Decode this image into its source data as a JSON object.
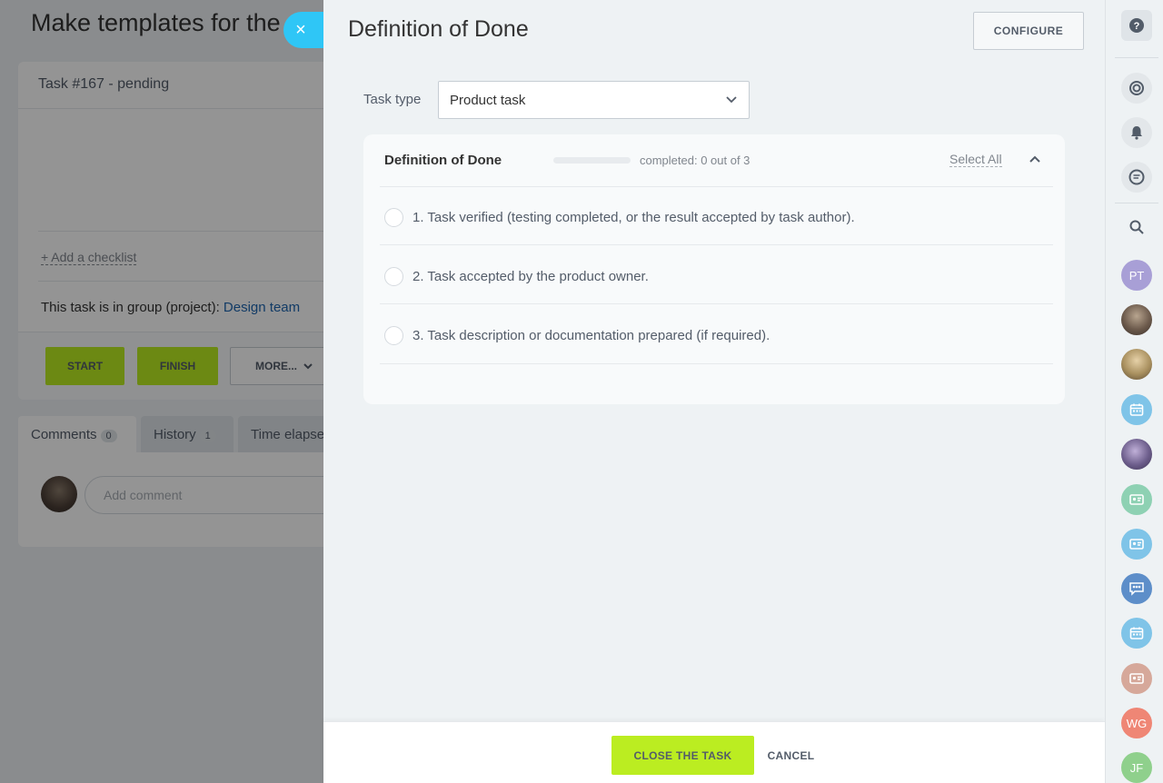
{
  "background_page": {
    "title": "Make templates for the p",
    "task_header": "Task #167 - pending",
    "add_checklist": "+ Add a checklist",
    "group_text": "This task is in group (project):",
    "group_link": "Design team",
    "buttons": {
      "start": "START",
      "finish": "FINISH",
      "more": "MORE..."
    },
    "tabs": [
      {
        "label": "Comments",
        "count": "0"
      },
      {
        "label": "History",
        "count": "1"
      },
      {
        "label": "Time elapse"
      }
    ],
    "comment_placeholder": "Add comment"
  },
  "slider": {
    "close_label": "×",
    "title": "Definition of Done",
    "configure_label": "CONFIGURE",
    "task_type_label": "Task type",
    "task_type_value": "Product task",
    "checklist": {
      "title": "Definition of Done",
      "progress_fraction": 0,
      "completed_text": "completed: 0 out of 3",
      "select_all": "Select All",
      "items": [
        {
          "label": "1. Task verified (testing completed, or the result accepted by task author).",
          "checked": false
        },
        {
          "label": "2. Task accepted by the product owner.",
          "checked": false
        },
        {
          "label": "3. Task description or documentation prepared (if required).",
          "checked": false
        }
      ]
    },
    "footer": {
      "close_task": "CLOSE THE TASK",
      "cancel": "CANCEL"
    }
  },
  "right_sidebar": {
    "items": [
      {
        "type": "icon",
        "icon": "help-icon"
      },
      {
        "type": "icon",
        "icon": "copilot-icon"
      },
      {
        "type": "icon",
        "icon": "bell-icon"
      },
      {
        "type": "icon",
        "icon": "chat-icon"
      },
      {
        "type": "icon",
        "icon": "search-icon"
      },
      {
        "type": "initials",
        "text": "PT",
        "color": "#a89fd6"
      },
      {
        "type": "photo",
        "icon": "user-photo"
      },
      {
        "type": "photo",
        "icon": "user-photo"
      },
      {
        "type": "icon",
        "icon": "calendar-icon",
        "color": "#7fc4e8"
      },
      {
        "type": "photo",
        "icon": "user-photo"
      },
      {
        "type": "icon",
        "icon": "contact-card-icon",
        "color": "#8ed1b3"
      },
      {
        "type": "icon",
        "icon": "contact-card-icon",
        "color": "#7fc4e8"
      },
      {
        "type": "icon",
        "icon": "group-chat-icon",
        "color": "#5d8ec9"
      },
      {
        "type": "icon",
        "icon": "calendar-icon",
        "color": "#7fc4e8"
      },
      {
        "type": "icon",
        "icon": "contact-card-icon",
        "color": "#d6a89a"
      },
      {
        "type": "initials",
        "text": "WG",
        "color": "#ef8675"
      },
      {
        "type": "initials",
        "text": "JF",
        "color": "#8fd08c"
      }
    ]
  },
  "colors": {
    "accent_green": "#bbed21",
    "close_blue": "#2fc6f6",
    "link_blue": "#2067b0"
  }
}
